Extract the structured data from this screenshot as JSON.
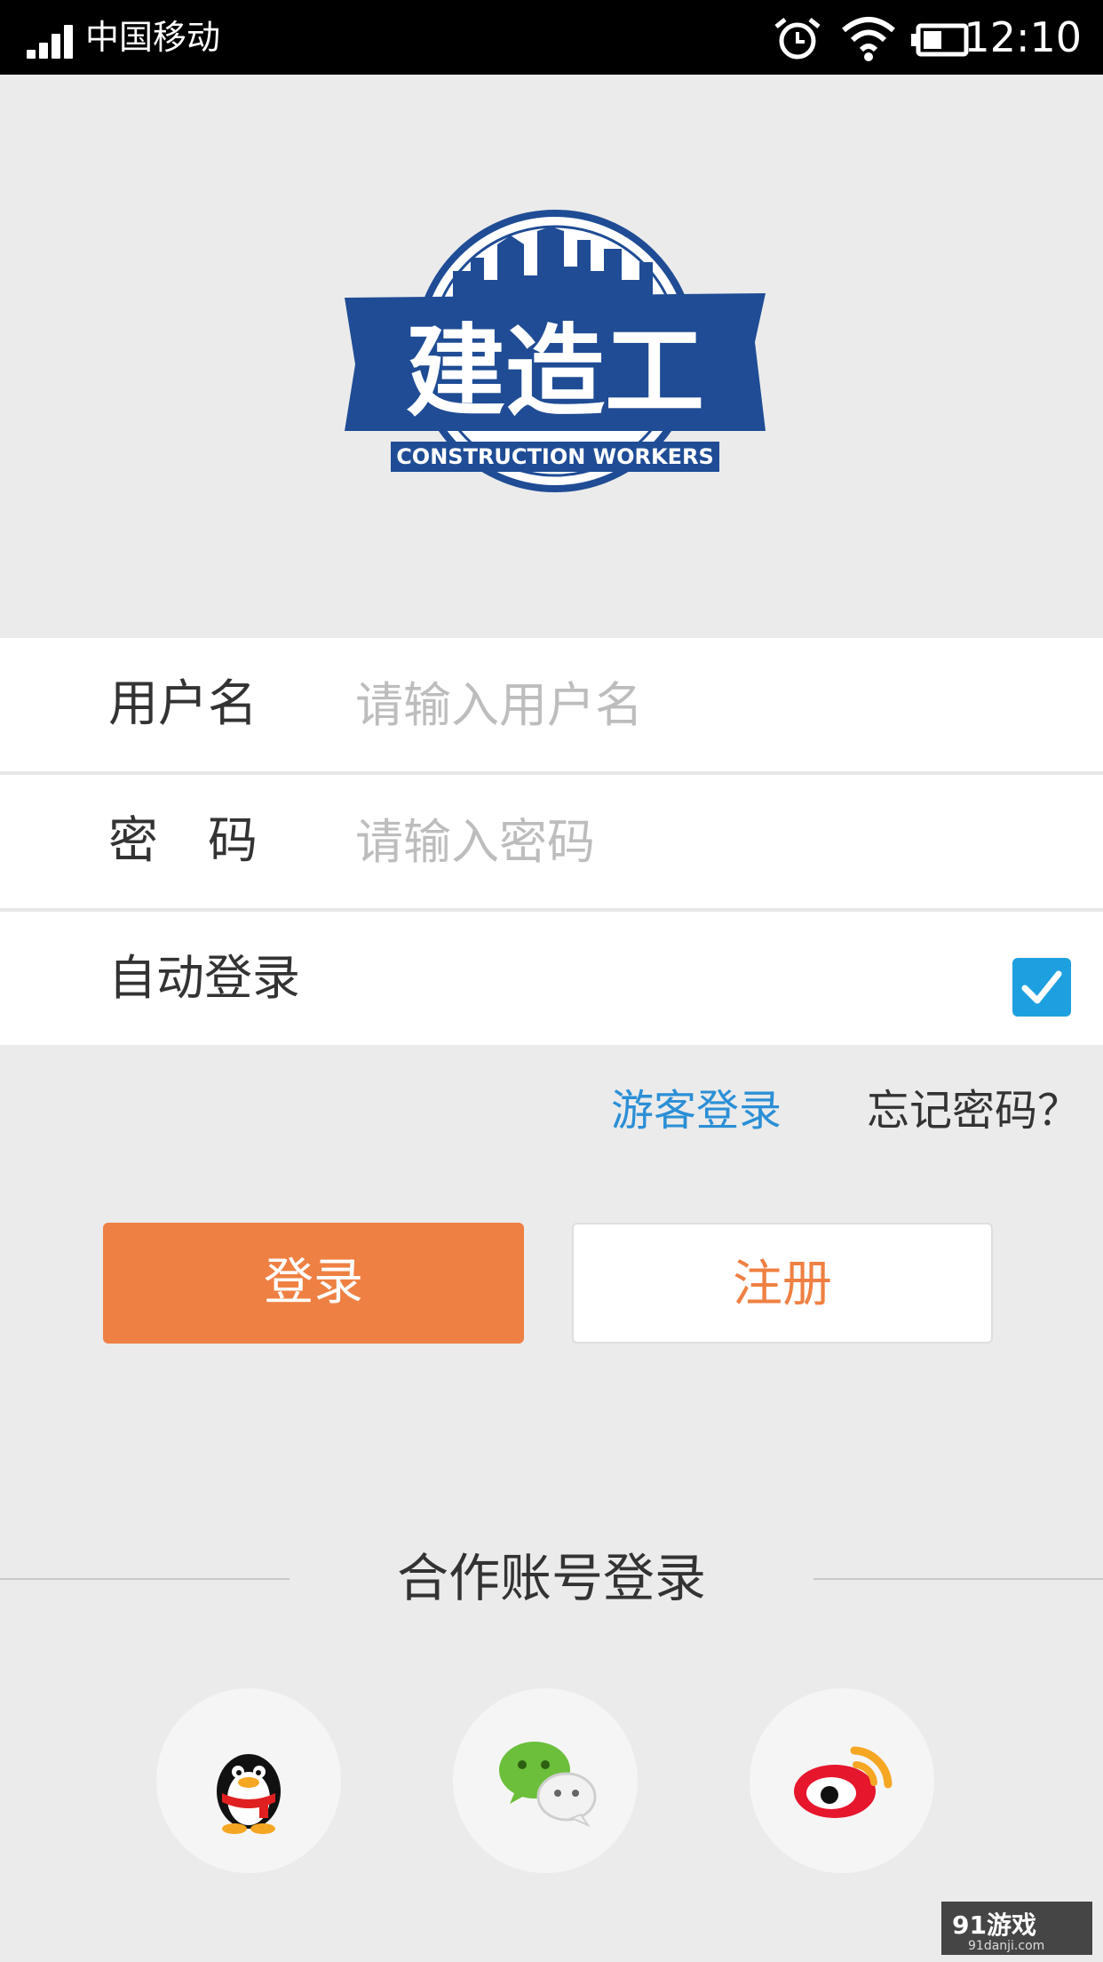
{
  "status_bar": {
    "carrier": "中国移动",
    "time": "12:10",
    "icons": [
      "signal-icon",
      "alarm-icon",
      "wifi-icon",
      "battery-icon"
    ]
  },
  "logo": {
    "title": "建造工",
    "subtitle": "CONSTRUCTION WORKERS",
    "colors": {
      "primary": "#1f4c95",
      "background": "#ffffff"
    }
  },
  "form": {
    "username": {
      "label": "用户名",
      "placeholder": "请输入用户名",
      "value": ""
    },
    "password": {
      "label": "密　码",
      "placeholder": "请输入密码",
      "value": ""
    },
    "auto_login": {
      "label": "自动登录",
      "checked": true
    }
  },
  "links": {
    "guest_login": "游客登录",
    "forgot_password": "忘记密码？"
  },
  "buttons": {
    "login": "登录",
    "register": "注册"
  },
  "partner": {
    "title": "合作账号登录",
    "providers": [
      "qq-icon",
      "wechat-icon",
      "weibo-icon"
    ]
  },
  "watermark": {
    "brand": "91游戏",
    "domain": "91danji.com"
  },
  "colors": {
    "accent": "#ef8043",
    "link": "#2b8fd6",
    "checkbox": "#1ea0e0",
    "background": "#ebebeb"
  }
}
